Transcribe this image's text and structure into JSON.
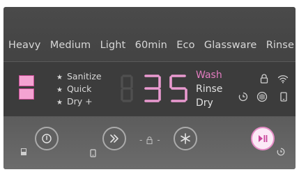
{
  "programs": [
    "Heavy",
    "Medium",
    "Light",
    "60min",
    "Eco",
    "Glassware",
    "Rinse"
  ],
  "options": [
    "Sanitize",
    "Quick",
    "Dry +"
  ],
  "option_marker": "★",
  "display": {
    "time": "35"
  },
  "stages": [
    {
      "label": "Wash",
      "active": true
    },
    {
      "label": "Rinse",
      "active": false
    },
    {
      "label": "Dry",
      "active": false
    }
  ],
  "status_icons": [
    "lock-icon",
    "wifi-icon",
    "delay-timer-icon",
    "rinse-aid-icon",
    "phone-icon"
  ],
  "controls": {
    "power": "power-icon",
    "program_select": "fast-forward-icon",
    "lock_separator": "- 🔒 -",
    "option": "star-icon",
    "start_pause": "play-pause-icon"
  },
  "colors": {
    "accent": "#e37cc0",
    "panel": "#434343",
    "text": "#d8d8d8"
  }
}
